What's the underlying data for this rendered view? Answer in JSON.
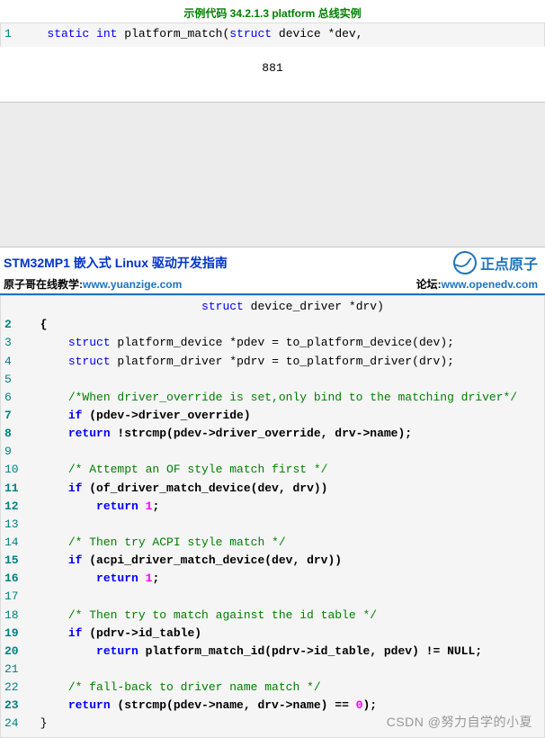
{
  "caption": "示例代码 34.2.1.3 platform 总线实例",
  "page_number": "881",
  "header": {
    "title": "STM32MP1 嵌入式 Linux 驱动开发指南",
    "brand": "正点原子",
    "sub_left_label": "原子哥在线教学:",
    "sub_left_url": "www.yuanzige.com",
    "sub_right_label": "论坛:",
    "sub_right_url": "www.openedv.com"
  },
  "watermark": "CSDN @努力自学的小夏",
  "top_code": {
    "lines": [
      {
        "n": "1",
        "bold": false,
        "segs": [
          {
            "t": "   ",
            "c": ""
          },
          {
            "t": "static",
            "c": "kw"
          },
          {
            "t": " ",
            "c": ""
          },
          {
            "t": "int",
            "c": "kw"
          },
          {
            "t": " platform_match",
            "c": "id"
          },
          {
            "t": "(",
            "c": ""
          },
          {
            "t": "struct",
            "c": "kw"
          },
          {
            "t": " device ",
            "c": "id"
          },
          {
            "t": "*",
            "c": ""
          },
          {
            "t": "dev",
            "c": "id"
          },
          {
            "t": ",",
            "c": ""
          }
        ]
      }
    ]
  },
  "main_code": {
    "lines": [
      {
        "n": "",
        "bold": false,
        "segs": [
          {
            "t": "                         ",
            "c": ""
          },
          {
            "t": "struct",
            "c": "kw"
          },
          {
            "t": " device_driver ",
            "c": "id"
          },
          {
            "t": "*",
            "c": ""
          },
          {
            "t": "drv",
            "c": "id"
          },
          {
            "t": ")",
            "c": ""
          }
        ]
      },
      {
        "n": "2",
        "bold": true,
        "segs": [
          {
            "t": "  {",
            "c": "id bold"
          }
        ]
      },
      {
        "n": "3",
        "bold": false,
        "segs": [
          {
            "t": "      ",
            "c": ""
          },
          {
            "t": "struct",
            "c": "kw"
          },
          {
            "t": " platform_device ",
            "c": "id"
          },
          {
            "t": "*",
            "c": ""
          },
          {
            "t": "pdev",
            "c": "id"
          },
          {
            "t": " = ",
            "c": ""
          },
          {
            "t": "to_platform_device",
            "c": "id"
          },
          {
            "t": "(",
            "c": ""
          },
          {
            "t": "dev",
            "c": "id"
          },
          {
            "t": ");",
            "c": ""
          }
        ]
      },
      {
        "n": "4",
        "bold": false,
        "segs": [
          {
            "t": "      ",
            "c": ""
          },
          {
            "t": "struct",
            "c": "kw"
          },
          {
            "t": " platform_driver ",
            "c": "id"
          },
          {
            "t": "*",
            "c": ""
          },
          {
            "t": "pdrv",
            "c": "id"
          },
          {
            "t": " = ",
            "c": ""
          },
          {
            "t": "to_platform_driver",
            "c": "id"
          },
          {
            "t": "(",
            "c": ""
          },
          {
            "t": "drv",
            "c": "id"
          },
          {
            "t": ");",
            "c": ""
          }
        ]
      },
      {
        "n": "5",
        "bold": false,
        "segs": [
          {
            "t": " ",
            "c": ""
          }
        ]
      },
      {
        "n": "6",
        "bold": false,
        "segs": [
          {
            "t": "      ",
            "c": ""
          },
          {
            "t": "/*When driver_override is set,only bind to the matching driver*/",
            "c": "cmt"
          }
        ]
      },
      {
        "n": "7",
        "bold": true,
        "segs": [
          {
            "t": "      ",
            "c": ""
          },
          {
            "t": "if",
            "c": "kw bold"
          },
          {
            "t": " (pdev->driver_override)",
            "c": "id bold"
          }
        ]
      },
      {
        "n": "8",
        "bold": true,
        "segs": [
          {
            "t": "      ",
            "c": ""
          },
          {
            "t": "return",
            "c": "kw bold"
          },
          {
            "t": " !strcmp(pdev->driver_override, drv->name);",
            "c": "id bold"
          }
        ]
      },
      {
        "n": "9",
        "bold": false,
        "segs": [
          {
            "t": " ",
            "c": ""
          }
        ]
      },
      {
        "n": "10",
        "bold": false,
        "segs": [
          {
            "t": "      ",
            "c": ""
          },
          {
            "t": "/* Attempt an OF style match first */",
            "c": "cmt"
          }
        ]
      },
      {
        "n": "11",
        "bold": true,
        "segs": [
          {
            "t": "      ",
            "c": ""
          },
          {
            "t": "if",
            "c": "kw bold"
          },
          {
            "t": " (of_driver_match_device(dev, drv))",
            "c": "id bold"
          }
        ]
      },
      {
        "n": "12",
        "bold": true,
        "segs": [
          {
            "t": "          ",
            "c": ""
          },
          {
            "t": "return",
            "c": "kw bold"
          },
          {
            "t": " ",
            "c": ""
          },
          {
            "t": "1",
            "c": "num bold"
          },
          {
            "t": ";",
            "c": "id bold"
          }
        ]
      },
      {
        "n": "13",
        "bold": false,
        "segs": [
          {
            "t": " ",
            "c": ""
          }
        ]
      },
      {
        "n": "14",
        "bold": false,
        "segs": [
          {
            "t": "      ",
            "c": ""
          },
          {
            "t": "/* Then try ACPI style match */",
            "c": "cmt"
          }
        ]
      },
      {
        "n": "15",
        "bold": true,
        "segs": [
          {
            "t": "      ",
            "c": ""
          },
          {
            "t": "if",
            "c": "kw bold"
          },
          {
            "t": " (acpi_driver_match_device(dev, drv))",
            "c": "id bold"
          }
        ]
      },
      {
        "n": "16",
        "bold": true,
        "segs": [
          {
            "t": "          ",
            "c": ""
          },
          {
            "t": "return",
            "c": "kw bold"
          },
          {
            "t": " ",
            "c": ""
          },
          {
            "t": "1",
            "c": "num bold"
          },
          {
            "t": ";",
            "c": "id bold"
          }
        ]
      },
      {
        "n": "17",
        "bold": false,
        "segs": [
          {
            "t": " ",
            "c": ""
          }
        ]
      },
      {
        "n": "18",
        "bold": false,
        "segs": [
          {
            "t": "      ",
            "c": ""
          },
          {
            "t": "/* Then try to match against the id table */",
            "c": "cmt"
          }
        ]
      },
      {
        "n": "19",
        "bold": true,
        "segs": [
          {
            "t": "      ",
            "c": ""
          },
          {
            "t": "if",
            "c": "kw bold"
          },
          {
            "t": " (pdrv->id_table)",
            "c": "id bold"
          }
        ]
      },
      {
        "n": "20",
        "bold": true,
        "segs": [
          {
            "t": "          ",
            "c": ""
          },
          {
            "t": "return",
            "c": "kw bold"
          },
          {
            "t": " platform_match_id(pdrv->id_table, pdev) != NULL;",
            "c": "id bold"
          }
        ]
      },
      {
        "n": "21",
        "bold": false,
        "segs": [
          {
            "t": " ",
            "c": ""
          }
        ]
      },
      {
        "n": "22",
        "bold": false,
        "segs": [
          {
            "t": "      ",
            "c": ""
          },
          {
            "t": "/* fall-back to driver name match */",
            "c": "cmt"
          }
        ]
      },
      {
        "n": "23",
        "bold": true,
        "segs": [
          {
            "t": "      ",
            "c": ""
          },
          {
            "t": "return",
            "c": "kw bold"
          },
          {
            "t": " (strcmp(pdev->name, drv->name) == ",
            "c": "id bold"
          },
          {
            "t": "0",
            "c": "num bold"
          },
          {
            "t": ");",
            "c": "id bold"
          }
        ]
      },
      {
        "n": "24",
        "bold": false,
        "segs": [
          {
            "t": "  }",
            "c": "id"
          }
        ]
      }
    ]
  }
}
